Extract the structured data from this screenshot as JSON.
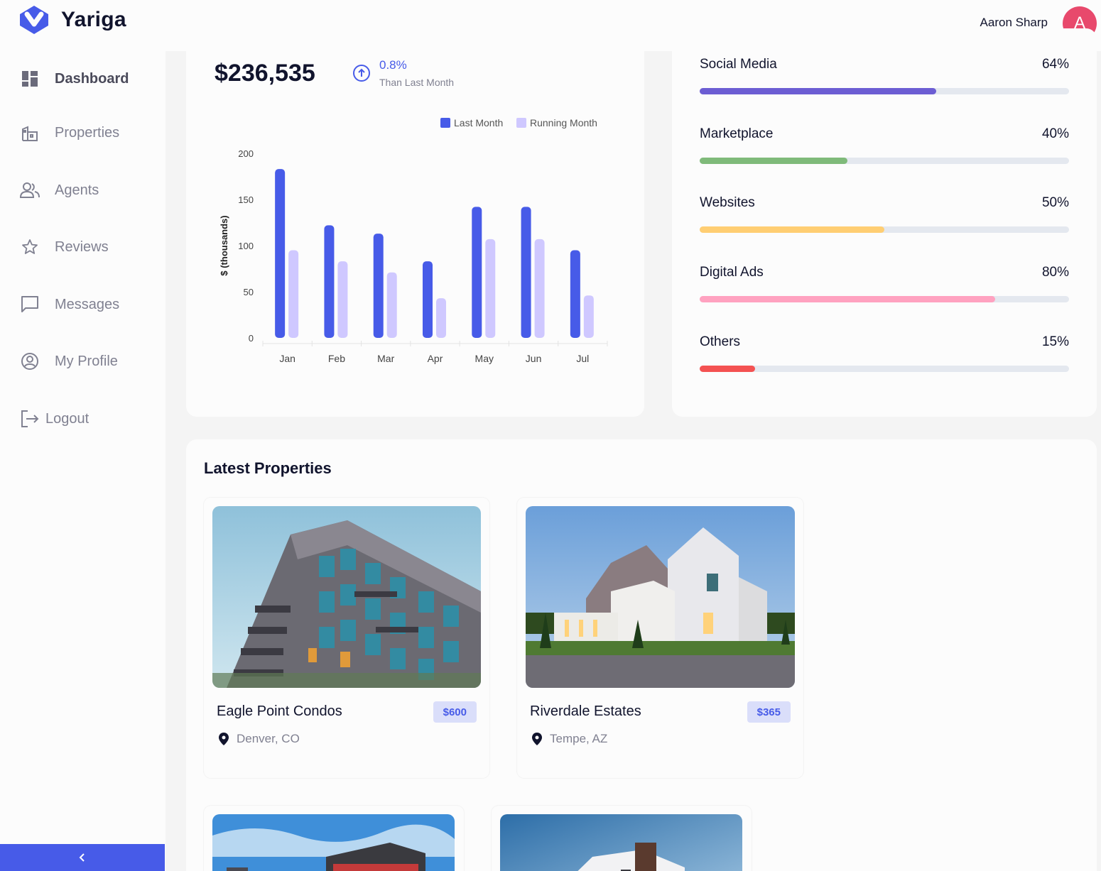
{
  "header": {
    "app_name": "Yariga",
    "user_name": "Aaron Sharp",
    "avatar_initial": "A"
  },
  "sidebar": {
    "items": [
      {
        "label": "Dashboard",
        "icon": "dashboard-icon",
        "active": true
      },
      {
        "label": "Properties",
        "icon": "properties-icon"
      },
      {
        "label": "Agents",
        "icon": "agents-icon"
      },
      {
        "label": "Reviews",
        "icon": "star-icon"
      },
      {
        "label": "Messages",
        "icon": "message-icon"
      },
      {
        "label": "My Profile",
        "icon": "profile-icon"
      },
      {
        "label": "Logout",
        "icon": "logout-icon"
      }
    ],
    "collapse_icon": "chevron-left-icon"
  },
  "revenue": {
    "amount": "$236,535",
    "trend_value": "0.8%",
    "trend_label": "Than Last Month",
    "trend_icon": "arrow-up-circle-icon"
  },
  "colors": {
    "primary": "#475be8",
    "secondary": "#cfc8ff",
    "avatar": "#e8496c"
  },
  "chart_data": {
    "type": "bar",
    "categories": [
      "Jan",
      "Feb",
      "Mar",
      "Apr",
      "May",
      "Jun",
      "Jul"
    ],
    "series": [
      {
        "name": "Last Month",
        "values": [
          183,
          122,
          113,
          83,
          142,
          142,
          95
        ],
        "color": "#475be8"
      },
      {
        "name": "Running Month",
        "values": [
          95,
          83,
          71,
          43,
          107,
          107,
          46
        ],
        "color": "#cfc8ff"
      }
    ],
    "ylabel": "$ (thousands)",
    "xlabel": "",
    "ylim": [
      0,
      200
    ],
    "yticks": [
      0,
      50,
      100,
      150,
      200
    ],
    "legend_position": "top-right",
    "grid": false
  },
  "sources": [
    {
      "name": "Social Media",
      "percent_label": "64%",
      "value": 64,
      "color": "#6c5dd3"
    },
    {
      "name": "Marketplace",
      "percent_label": "40%",
      "value": 40,
      "color": "#7fba7a"
    },
    {
      "name": "Websites",
      "percent_label": "50%",
      "value": 50,
      "color": "#ffce73"
    },
    {
      "name": "Digital Ads",
      "percent_label": "80%",
      "value": 80,
      "color": "#ffa2c0"
    },
    {
      "name": "Others",
      "percent_label": "15%",
      "value": 15,
      "color": "#f45252"
    }
  ],
  "latest": {
    "title": "Latest Properties",
    "properties": [
      {
        "name": "Eagle Point Condos",
        "price": "$600",
        "location": "Denver, CO"
      },
      {
        "name": "Riverdale Estates",
        "price": "$365",
        "location": "Tempe, AZ"
      },
      {
        "name": "",
        "price": "",
        "location": ""
      },
      {
        "name": "",
        "price": "",
        "location": ""
      }
    ]
  }
}
